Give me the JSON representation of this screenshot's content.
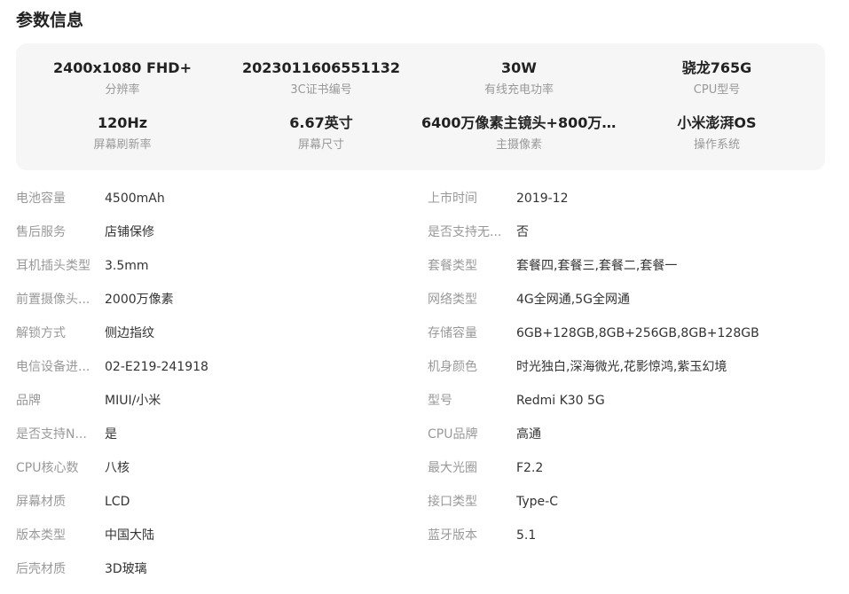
{
  "title": "参数信息",
  "highlights": [
    {
      "value": "2400x1080 FHD+",
      "label": "分辨率"
    },
    {
      "value": "202301160655113​2",
      "label": "3C证书编号"
    },
    {
      "value": "30W",
      "label": "有线充电功率"
    },
    {
      "value": "骁龙765G",
      "label": "CPU型号"
    },
    {
      "value": "120Hz",
      "label": "屏幕刷新率"
    },
    {
      "value": "6.67英寸",
      "label": "屏幕尺寸"
    },
    {
      "value": "6400万像素主镜头+800万...",
      "label": "主摄像素"
    },
    {
      "value": "小米澎湃OS",
      "label": "操作系统"
    }
  ],
  "specs_left": [
    {
      "label": "电池容量",
      "value": "4500mAh"
    },
    {
      "label": "售后服务",
      "value": "店铺保修"
    },
    {
      "label": "耳机插头类型",
      "value": "3.5mm"
    },
    {
      "label": "前置摄像头...",
      "value": "2000万像素"
    },
    {
      "label": "解锁方式",
      "value": "侧边指纹"
    },
    {
      "label": "电信设备进...",
      "value": "02-E219-241918"
    },
    {
      "label": "品牌",
      "value": "MIUI/小米"
    },
    {
      "label": "是否支持N...",
      "value": "是"
    },
    {
      "label": "CPU核心数",
      "value": "八核"
    },
    {
      "label": "屏幕材质",
      "value": "LCD"
    },
    {
      "label": "版本类型",
      "value": "中国大陆"
    },
    {
      "label": "后壳材质",
      "value": "3D玻璃"
    }
  ],
  "specs_right": [
    {
      "label": "上市时间",
      "value": "2019-12"
    },
    {
      "label": "是否支持无...",
      "value": "否"
    },
    {
      "label": "套餐类型",
      "value": "套餐四,套餐三,套餐二,套餐一"
    },
    {
      "label": "网络类型",
      "value": "4G全网通,5G全网通"
    },
    {
      "label": "存储容量",
      "value": "6GB+128GB,8GB+256GB,8GB+128GB"
    },
    {
      "label": "机身颜色",
      "value": "时光独白,深海微光,花影惊鸿,紫玉幻境"
    },
    {
      "label": "型号",
      "value": "Redmi K30 5G"
    },
    {
      "label": "CPU品牌",
      "value": "高通"
    },
    {
      "label": "最大光圈",
      "value": "F2.2"
    },
    {
      "label": "接口类型",
      "value": "Type-C"
    },
    {
      "label": "蓝牙版本",
      "value": "5.1"
    }
  ]
}
